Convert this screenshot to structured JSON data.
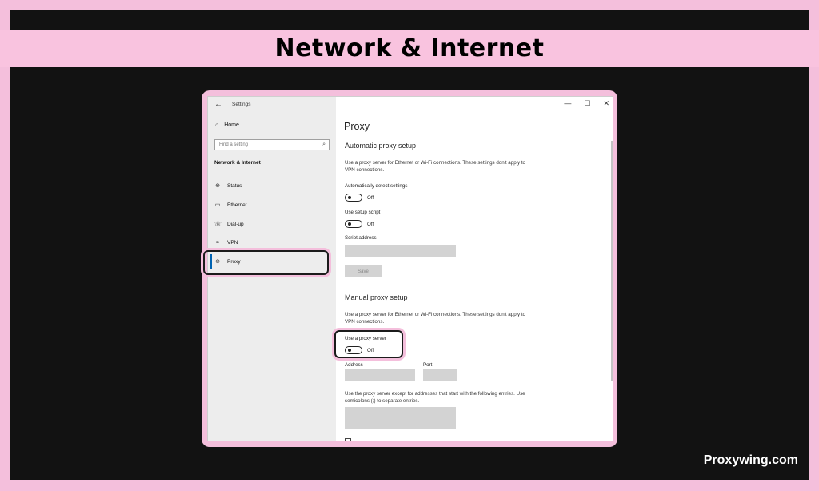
{
  "banner": {
    "title": "Network & Internet"
  },
  "window": {
    "title": "Settings",
    "controls": {
      "minimize": "—",
      "maximize": "☐",
      "close": "✕"
    }
  },
  "sidebar": {
    "home_label": "Home",
    "search_placeholder": "Find a setting",
    "section_label": "Network & Internet",
    "items": [
      {
        "label": "Status",
        "icon": "status-icon"
      },
      {
        "label": "Ethernet",
        "icon": "ethernet-icon"
      },
      {
        "label": "Dial-up",
        "icon": "dialup-icon"
      },
      {
        "label": "VPN",
        "icon": "vpn-icon"
      },
      {
        "label": "Proxy",
        "icon": "globe-icon",
        "selected": true
      }
    ]
  },
  "content": {
    "page_title": "Proxy",
    "automatic": {
      "heading": "Automatic proxy setup",
      "description": "Use a proxy server for Ethernet or Wi-Fi connections. These settings don't apply to VPN connections.",
      "auto_detect_label": "Automatically detect settings",
      "auto_detect_state": "Off",
      "setup_script_label": "Use setup script",
      "setup_script_state": "Off",
      "script_address_label": "Script address",
      "script_address_value": "",
      "save_label": "Save"
    },
    "manual": {
      "heading": "Manual proxy setup",
      "description": "Use a proxy server for Ethernet or Wi-Fi connections. These settings don't apply to VPN connections.",
      "use_proxy_label": "Use a proxy server",
      "use_proxy_state": "Off",
      "address_label": "Address",
      "address_value": "",
      "port_label": "Port",
      "port_value": "",
      "exceptions_description": "Use the proxy server except for addresses that start with the following entries. Use semicolons (;) to separate entries.",
      "exceptions_value": ""
    }
  },
  "footer": {
    "brand": "Proxywing.com"
  },
  "colors": {
    "accent_pink": "#f4bfdc",
    "background": "#121212",
    "selection_blue": "#0063b1"
  }
}
